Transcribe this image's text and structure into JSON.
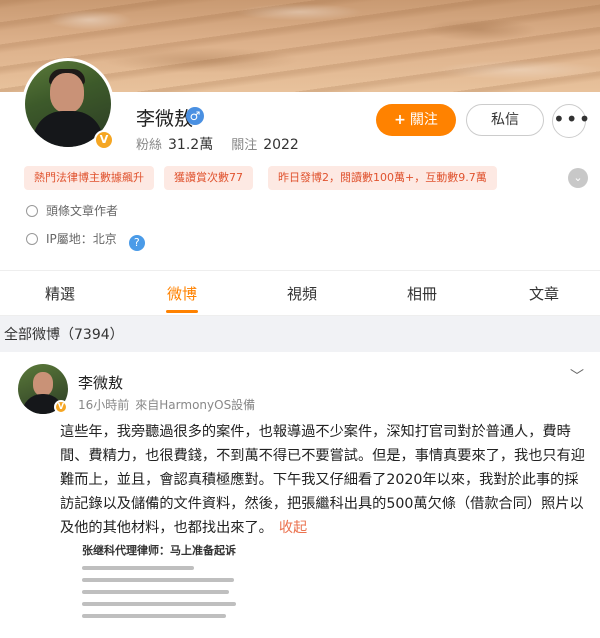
{
  "profile": {
    "name": "李微敖",
    "verified_badge": "V",
    "gender_icon": "♂",
    "fans_label": "粉絲",
    "fans_count": "31.2萬",
    "following_label": "關注",
    "following_count": "2022",
    "follow_button": "關注",
    "follow_plus": "+",
    "message_button": "私信",
    "more_button": "•••",
    "tags": [
      "熱門法律博主數據飆升",
      "獲讚賞次數77",
      "昨日發博2，閱讀數100萬+，互動數9.7萬"
    ],
    "headline_author": "頭條文章作者",
    "ip_location": "IP屬地：北京",
    "ip_help": "?"
  },
  "tabs": [
    {
      "label": "精選"
    },
    {
      "label": "微博"
    },
    {
      "label": "視頻"
    },
    {
      "label": "相冊"
    },
    {
      "label": "文章"
    }
  ],
  "active_tab": "微博",
  "all_posts_label": "全部微博（7394）",
  "post": {
    "author": "李微敖",
    "time": "16小時前",
    "source": "來自HarmonyOS設備",
    "text": "這些年，我旁聽過很多的案件，也報導過不少案件，深知打官司對於普通人，費時間、費精力，也很費錢，不到萬不得已不要嘗試。但是，事情真要來了，我也只有迎難而上，並且，會認真積極應對。下午我又仔細看了2020年以來，我對於此事的採訪記錄以及儲備的文件資料，然後，把張繼科出具的500萬欠條（借款合同）照片以及他的其他材料，也都找出來了。",
    "collapse_label": "收起",
    "article_title": "张继科代理律师：马上准备起诉"
  },
  "colors": {
    "accent": "#ff8200",
    "tag_bg": "#fde9e3",
    "tag_text": "#e0532f",
    "link": "#eb7350"
  }
}
